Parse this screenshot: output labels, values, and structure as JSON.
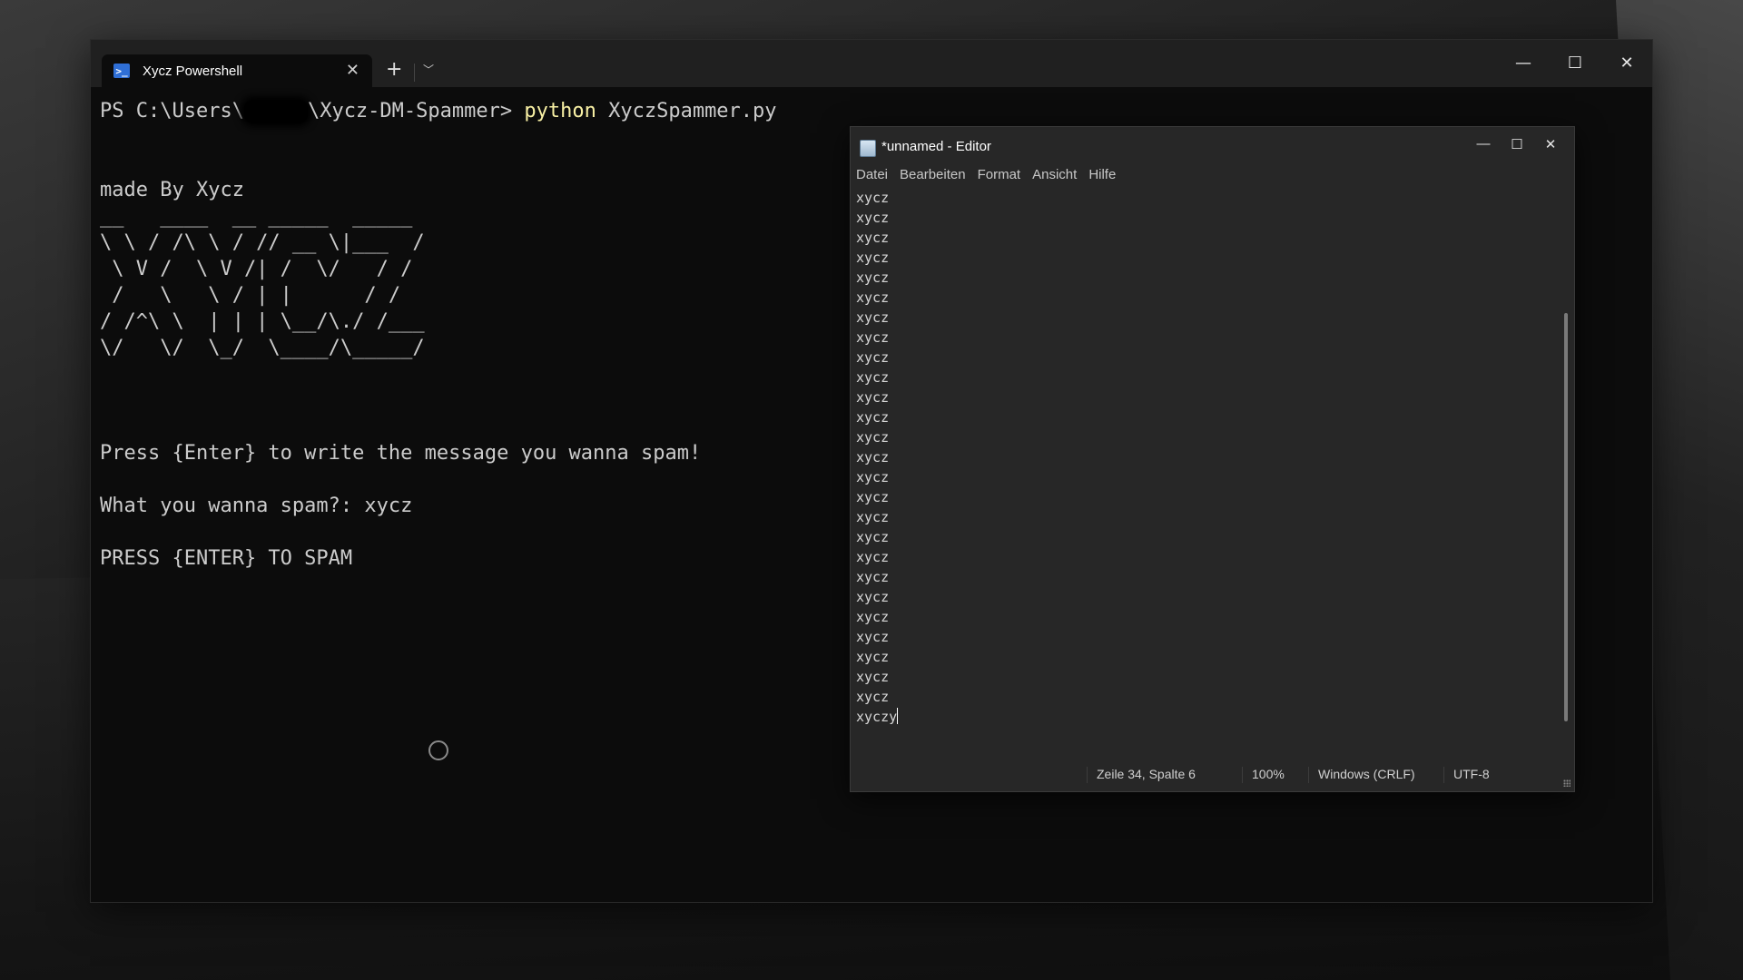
{
  "terminal": {
    "tab_title": "Xycz Powershell",
    "tab_icon": "powershell-icon",
    "prompt_prefix": "PS C:\\Users\\",
    "prompt_suffix": "\\Xycz-DM-Spammer> ",
    "command": "python",
    "command_args": " XyczSpammer.py",
    "made_by": "made By Xycz",
    "ascii_art": "__   ____  __ _____  _____\n\\ \\ / /\\ \\ / // __ \\|___  /\n \\ V /  \\ V /| /  \\/   / /\n /   \\   \\ / | |      / /\n/ /^\\ \\  | | | \\__/\\./ /___\n\\/   \\/  \\_/  \\____/\\_____/",
    "line_press_enter": "Press {Enter} to write the message you wanna spam!",
    "line_what_spam": "What you wanna spam?: xycz",
    "line_press_spam": "PRESS {ENTER} TO SPAM"
  },
  "notepad": {
    "title": "*unnamed - Editor",
    "menu": [
      "Datei",
      "Bearbeiten",
      "Format",
      "Ansicht",
      "Hilfe"
    ],
    "lines": [
      "xycz",
      "xycz",
      "xycz",
      "xycz",
      "xycz",
      "xycz",
      "xycz",
      "xycz",
      "xycz",
      "xycz",
      "xycz",
      "xycz",
      "xycz",
      "xycz",
      "xycz",
      "xycz",
      "xycz",
      "xycz",
      "xycz",
      "xycz",
      "xycz",
      "xycz",
      "xycz",
      "xycz",
      "xycz",
      "xycz"
    ],
    "last_line": "xyczy",
    "status": {
      "position": "Zeile 34, Spalte 6",
      "zoom": "100%",
      "line_ending": "Windows (CRLF)",
      "encoding": "UTF-8"
    }
  }
}
